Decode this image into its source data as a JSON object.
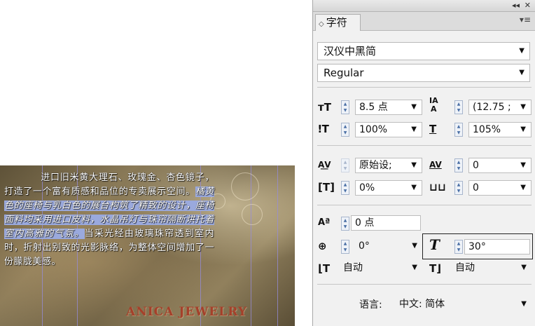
{
  "canvas": {
    "paragraph": {
      "lead": "进口旧米黄大理石、玫瑰金、杏色镜子，打造了一个富有质感和品位的专卖展示空间。",
      "highlighted": "橘黄色的座椅与乳白色的展台构筑了精致的设计，座椅面料均采用进口皮料，水晶吊灯与珠帘隔断烘托着室内高雅的气氛。",
      "tail": "当采光经由玻璃珠帘透到室内时，折射出别致的光影脉络，为整体空间增加了一份朦胧美感。"
    },
    "brand": "ANICA JEWELRY"
  },
  "panel": {
    "titlebar": {
      "collapse": "◂◂",
      "close": "✕"
    },
    "tab_label": "字符",
    "font_family": "汉仪中黑简",
    "font_style": "Regular",
    "font_size": "8.5 点",
    "leading": "(12.75 ;",
    "vertical_scale": "100%",
    "horizontal_scale": "105%",
    "kerning": "原始设;",
    "tracking": "0",
    "tsume": "0%",
    "aki": "0",
    "baseline_shift": "0 点",
    "rotation": "0°",
    "skew": "30°",
    "aki_before": "自动",
    "aki_after": "自动",
    "language_label": "语言:",
    "language": "中文: 简体"
  }
}
